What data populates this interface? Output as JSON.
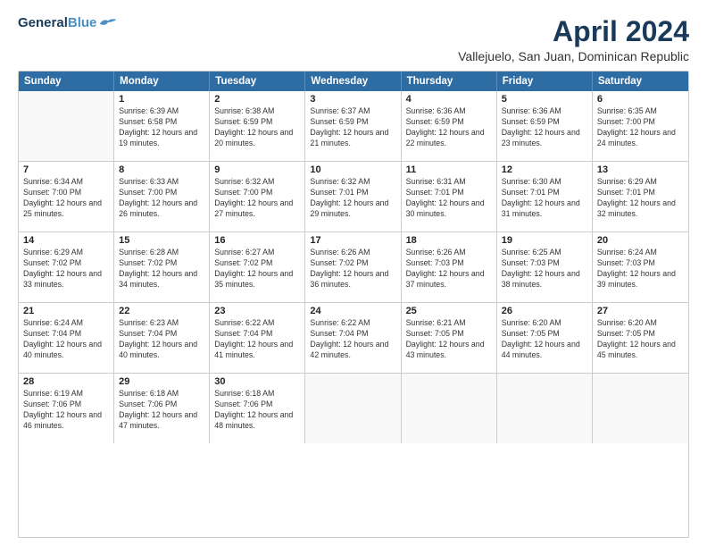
{
  "logo": {
    "line1": "General",
    "line2": "Blue"
  },
  "title": "April 2024",
  "subtitle": "Vallejuelo, San Juan, Dominican Republic",
  "header_days": [
    "Sunday",
    "Monday",
    "Tuesday",
    "Wednesday",
    "Thursday",
    "Friday",
    "Saturday"
  ],
  "weeks": [
    [
      {
        "day": "",
        "sunrise": "",
        "sunset": "",
        "daylight": ""
      },
      {
        "day": "1",
        "sunrise": "Sunrise: 6:39 AM",
        "sunset": "Sunset: 6:58 PM",
        "daylight": "Daylight: 12 hours and 19 minutes."
      },
      {
        "day": "2",
        "sunrise": "Sunrise: 6:38 AM",
        "sunset": "Sunset: 6:59 PM",
        "daylight": "Daylight: 12 hours and 20 minutes."
      },
      {
        "day": "3",
        "sunrise": "Sunrise: 6:37 AM",
        "sunset": "Sunset: 6:59 PM",
        "daylight": "Daylight: 12 hours and 21 minutes."
      },
      {
        "day": "4",
        "sunrise": "Sunrise: 6:36 AM",
        "sunset": "Sunset: 6:59 PM",
        "daylight": "Daylight: 12 hours and 22 minutes."
      },
      {
        "day": "5",
        "sunrise": "Sunrise: 6:36 AM",
        "sunset": "Sunset: 6:59 PM",
        "daylight": "Daylight: 12 hours and 23 minutes."
      },
      {
        "day": "6",
        "sunrise": "Sunrise: 6:35 AM",
        "sunset": "Sunset: 7:00 PM",
        "daylight": "Daylight: 12 hours and 24 minutes."
      }
    ],
    [
      {
        "day": "7",
        "sunrise": "Sunrise: 6:34 AM",
        "sunset": "Sunset: 7:00 PM",
        "daylight": "Daylight: 12 hours and 25 minutes."
      },
      {
        "day": "8",
        "sunrise": "Sunrise: 6:33 AM",
        "sunset": "Sunset: 7:00 PM",
        "daylight": "Daylight: 12 hours and 26 minutes."
      },
      {
        "day": "9",
        "sunrise": "Sunrise: 6:32 AM",
        "sunset": "Sunset: 7:00 PM",
        "daylight": "Daylight: 12 hours and 27 minutes."
      },
      {
        "day": "10",
        "sunrise": "Sunrise: 6:32 AM",
        "sunset": "Sunset: 7:01 PM",
        "daylight": "Daylight: 12 hours and 29 minutes."
      },
      {
        "day": "11",
        "sunrise": "Sunrise: 6:31 AM",
        "sunset": "Sunset: 7:01 PM",
        "daylight": "Daylight: 12 hours and 30 minutes."
      },
      {
        "day": "12",
        "sunrise": "Sunrise: 6:30 AM",
        "sunset": "Sunset: 7:01 PM",
        "daylight": "Daylight: 12 hours and 31 minutes."
      },
      {
        "day": "13",
        "sunrise": "Sunrise: 6:29 AM",
        "sunset": "Sunset: 7:01 PM",
        "daylight": "Daylight: 12 hours and 32 minutes."
      }
    ],
    [
      {
        "day": "14",
        "sunrise": "Sunrise: 6:29 AM",
        "sunset": "Sunset: 7:02 PM",
        "daylight": "Daylight: 12 hours and 33 minutes."
      },
      {
        "day": "15",
        "sunrise": "Sunrise: 6:28 AM",
        "sunset": "Sunset: 7:02 PM",
        "daylight": "Daylight: 12 hours and 34 minutes."
      },
      {
        "day": "16",
        "sunrise": "Sunrise: 6:27 AM",
        "sunset": "Sunset: 7:02 PM",
        "daylight": "Daylight: 12 hours and 35 minutes."
      },
      {
        "day": "17",
        "sunrise": "Sunrise: 6:26 AM",
        "sunset": "Sunset: 7:02 PM",
        "daylight": "Daylight: 12 hours and 36 minutes."
      },
      {
        "day": "18",
        "sunrise": "Sunrise: 6:26 AM",
        "sunset": "Sunset: 7:03 PM",
        "daylight": "Daylight: 12 hours and 37 minutes."
      },
      {
        "day": "19",
        "sunrise": "Sunrise: 6:25 AM",
        "sunset": "Sunset: 7:03 PM",
        "daylight": "Daylight: 12 hours and 38 minutes."
      },
      {
        "day": "20",
        "sunrise": "Sunrise: 6:24 AM",
        "sunset": "Sunset: 7:03 PM",
        "daylight": "Daylight: 12 hours and 39 minutes."
      }
    ],
    [
      {
        "day": "21",
        "sunrise": "Sunrise: 6:24 AM",
        "sunset": "Sunset: 7:04 PM",
        "daylight": "Daylight: 12 hours and 40 minutes."
      },
      {
        "day": "22",
        "sunrise": "Sunrise: 6:23 AM",
        "sunset": "Sunset: 7:04 PM",
        "daylight": "Daylight: 12 hours and 40 minutes."
      },
      {
        "day": "23",
        "sunrise": "Sunrise: 6:22 AM",
        "sunset": "Sunset: 7:04 PM",
        "daylight": "Daylight: 12 hours and 41 minutes."
      },
      {
        "day": "24",
        "sunrise": "Sunrise: 6:22 AM",
        "sunset": "Sunset: 7:04 PM",
        "daylight": "Daylight: 12 hours and 42 minutes."
      },
      {
        "day": "25",
        "sunrise": "Sunrise: 6:21 AM",
        "sunset": "Sunset: 7:05 PM",
        "daylight": "Daylight: 12 hours and 43 minutes."
      },
      {
        "day": "26",
        "sunrise": "Sunrise: 6:20 AM",
        "sunset": "Sunset: 7:05 PM",
        "daylight": "Daylight: 12 hours and 44 minutes."
      },
      {
        "day": "27",
        "sunrise": "Sunrise: 6:20 AM",
        "sunset": "Sunset: 7:05 PM",
        "daylight": "Daylight: 12 hours and 45 minutes."
      }
    ],
    [
      {
        "day": "28",
        "sunrise": "Sunrise: 6:19 AM",
        "sunset": "Sunset: 7:06 PM",
        "daylight": "Daylight: 12 hours and 46 minutes."
      },
      {
        "day": "29",
        "sunrise": "Sunrise: 6:18 AM",
        "sunset": "Sunset: 7:06 PM",
        "daylight": "Daylight: 12 hours and 47 minutes."
      },
      {
        "day": "30",
        "sunrise": "Sunrise: 6:18 AM",
        "sunset": "Sunset: 7:06 PM",
        "daylight": "Daylight: 12 hours and 48 minutes."
      },
      {
        "day": "",
        "sunrise": "",
        "sunset": "",
        "daylight": ""
      },
      {
        "day": "",
        "sunrise": "",
        "sunset": "",
        "daylight": ""
      },
      {
        "day": "",
        "sunrise": "",
        "sunset": "",
        "daylight": ""
      },
      {
        "day": "",
        "sunrise": "",
        "sunset": "",
        "daylight": ""
      }
    ]
  ]
}
